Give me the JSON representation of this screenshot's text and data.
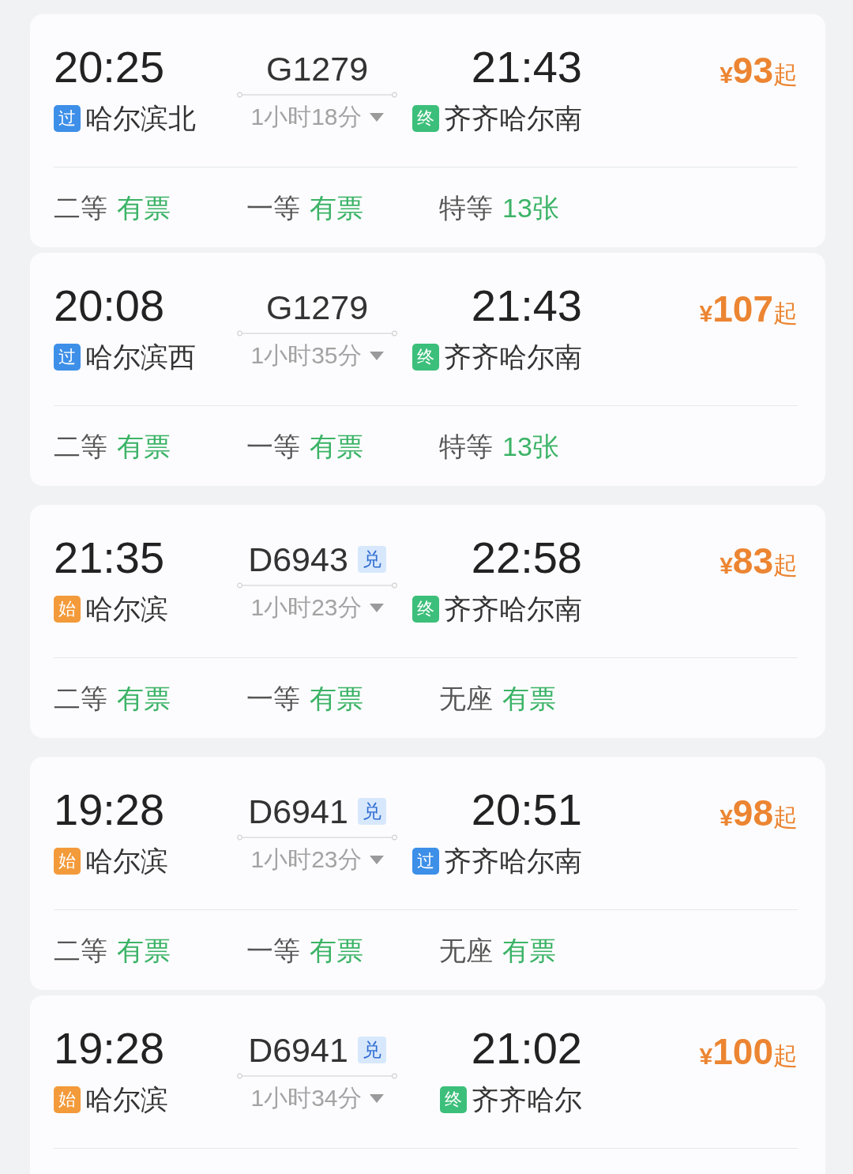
{
  "trains": [
    {
      "depart": {
        "time": "20:25",
        "tag": {
          "label": "过",
          "color": "#3d8fe8"
        },
        "station": "哈尔滨北"
      },
      "train": {
        "number": "G1279"
      },
      "duration": "1小时18分",
      "arrive": {
        "time": "21:43",
        "tag": {
          "label": "终",
          "color": "#3cbf7a"
        },
        "station": "齐齐哈尔南"
      },
      "price": {
        "currency": "¥",
        "amount": "93",
        "suffix": "起"
      },
      "seats": [
        {
          "class": "二等",
          "availability": "有票"
        },
        {
          "class": "一等",
          "availability": "有票"
        },
        {
          "class": "特等",
          "availability": "13张"
        }
      ]
    },
    {
      "depart": {
        "time": "20:08",
        "tag": {
          "label": "过",
          "color": "#3d8fe8"
        },
        "station": "哈尔滨西"
      },
      "train": {
        "number": "G1279"
      },
      "duration": "1小时35分",
      "arrive": {
        "time": "21:43",
        "tag": {
          "label": "终",
          "color": "#3cbf7a"
        },
        "station": "齐齐哈尔南"
      },
      "price": {
        "currency": "¥",
        "amount": "107",
        "suffix": "起"
      },
      "seats": [
        {
          "class": "二等",
          "availability": "有票"
        },
        {
          "class": "一等",
          "availability": "有票"
        },
        {
          "class": "特等",
          "availability": "13张"
        }
      ]
    },
    {
      "depart": {
        "time": "21:35",
        "tag": {
          "label": "始",
          "color": "#f39a3a"
        },
        "station": "哈尔滨"
      },
      "train": {
        "number": "D6943",
        "tag": "兑"
      },
      "duration": "1小时23分",
      "arrive": {
        "time": "22:58",
        "tag": {
          "label": "终",
          "color": "#3cbf7a"
        },
        "station": "齐齐哈尔南"
      },
      "price": {
        "currency": "¥",
        "amount": "83",
        "suffix": "起"
      },
      "seats": [
        {
          "class": "二等",
          "availability": "有票"
        },
        {
          "class": "一等",
          "availability": "有票"
        },
        {
          "class": "无座",
          "availability": "有票"
        }
      ]
    },
    {
      "depart": {
        "time": "19:28",
        "tag": {
          "label": "始",
          "color": "#f39a3a"
        },
        "station": "哈尔滨"
      },
      "train": {
        "number": "D6941",
        "tag": "兑"
      },
      "duration": "1小时23分",
      "arrive": {
        "time": "20:51",
        "tag": {
          "label": "过",
          "color": "#3d8fe8"
        },
        "station": "齐齐哈尔南"
      },
      "price": {
        "currency": "¥",
        "amount": "98",
        "suffix": "起"
      },
      "seats": [
        {
          "class": "二等",
          "availability": "有票"
        },
        {
          "class": "一等",
          "availability": "有票"
        },
        {
          "class": "无座",
          "availability": "有票"
        }
      ]
    },
    {
      "depart": {
        "time": "19:28",
        "tag": {
          "label": "始",
          "color": "#f39a3a"
        },
        "station": "哈尔滨"
      },
      "train": {
        "number": "D6941",
        "tag": "兑"
      },
      "duration": "1小时34分",
      "arrive": {
        "time": "21:02",
        "tag": {
          "label": "终",
          "color": "#3cbf7a"
        },
        "station": "齐齐哈尔"
      },
      "price": {
        "currency": "¥",
        "amount": "100",
        "suffix": "起"
      }
    }
  ]
}
